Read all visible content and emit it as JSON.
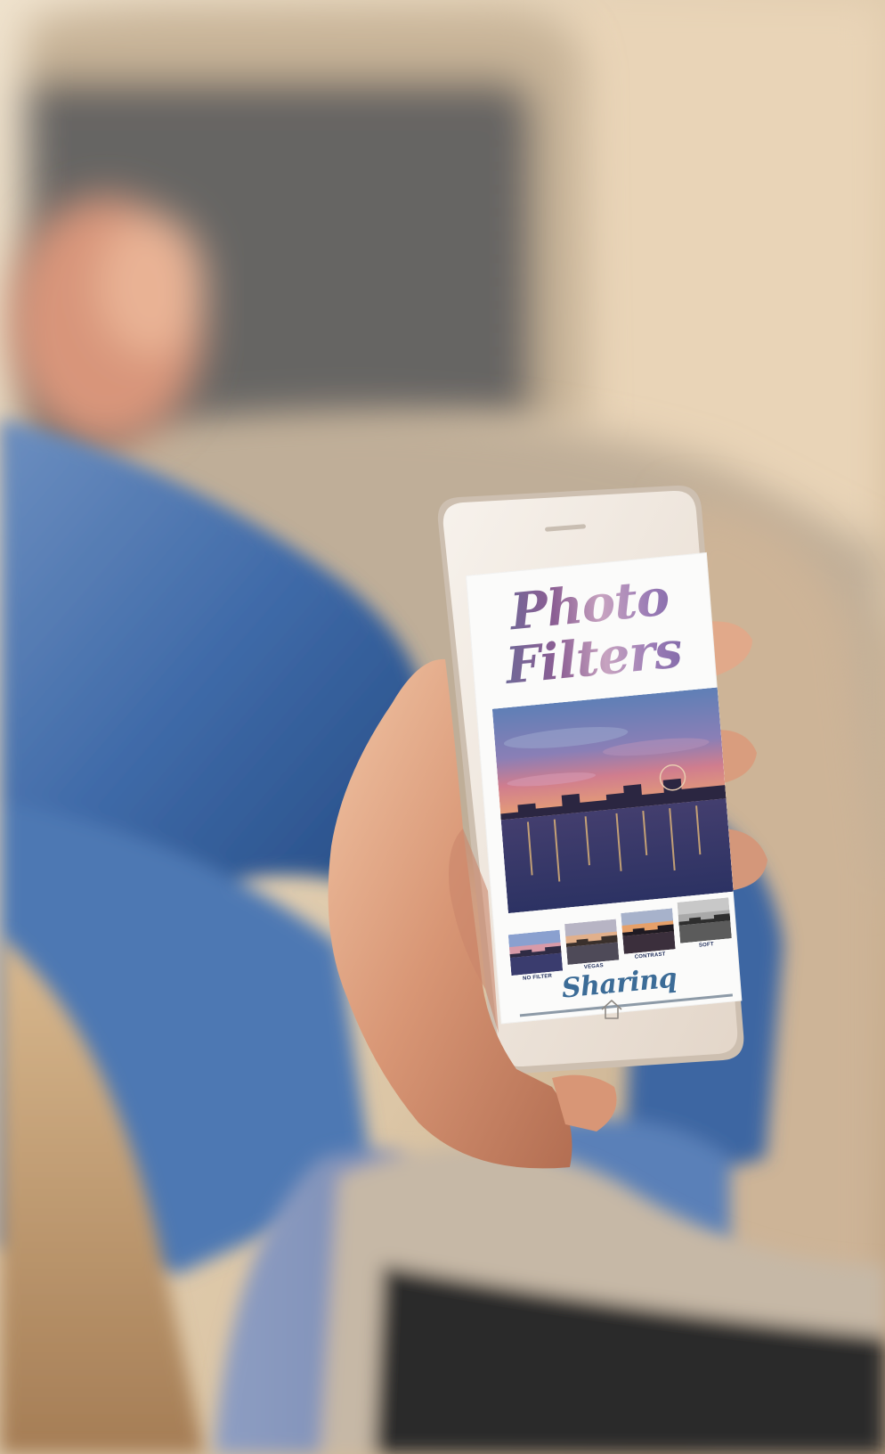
{
  "app": {
    "title_line_1": "Photo",
    "title_line_2": "Filters",
    "brand": "Sharinq"
  },
  "filters": [
    {
      "label": "NO FILTER",
      "tone": "normal"
    },
    {
      "label": "VEGAS",
      "tone": "warm"
    },
    {
      "label": "CONTRAST",
      "tone": "contrast"
    },
    {
      "label": "SOFT",
      "tone": "grayscale"
    }
  ],
  "colors": {
    "title_gradient": [
      "#5f6f9a",
      "#8b5e93",
      "#c7a3c0",
      "#6b5a9d"
    ],
    "brand": "#3c6c97",
    "filter_label": "#1e2c5a",
    "phone_body": "#f3ede6",
    "screen": "#fbfbfa"
  },
  "icons": {
    "home": "home-icon"
  }
}
